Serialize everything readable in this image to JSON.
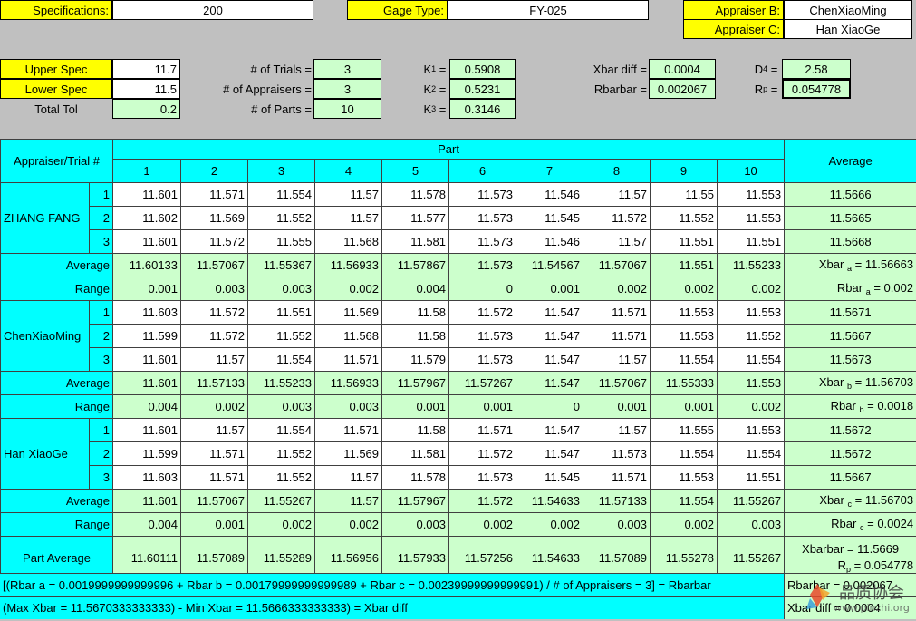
{
  "header": {
    "spec_label": "Specifications:",
    "spec_value": "200",
    "gage_type_label": "Gage Type:",
    "gage_type_value": "FY-025",
    "appraiser_b_label": "Appraiser B:",
    "appraiser_b_value": "ChenXiaoMing",
    "appraiser_c_label": "Appraiser C:",
    "appraiser_c_value": "Han XiaoGe"
  },
  "params": {
    "upper_spec_label": "Upper Spec",
    "upper_spec_value": "11.7",
    "lower_spec_label": "Lower Spec",
    "lower_spec_value": "11.5",
    "total_tol_label": "Total Tol",
    "total_tol_value": "0.2",
    "trials_label": "# of Trials =",
    "trials_value": "3",
    "appraisers_label": "# of Appraisers =",
    "appraisers_value": "3",
    "parts_label": "# of Parts =",
    "parts_value": "10",
    "k1_label": "K",
    "k1_sub": "1",
    "k1_value": "0.5908",
    "k2_label": "K",
    "k2_sub": "2",
    "k2_value": "0.5231",
    "k3_label": "K",
    "k3_sub": "3",
    "k3_value": "0.3146",
    "xbar_diff_label": "Xbar diff =",
    "xbar_diff_value": "0.0004",
    "rbarbar_label": "Rbarbar =",
    "rbarbar_value": "0.002067",
    "d4_label": "D",
    "d4_sub": "4",
    "d4_value": "2.58",
    "rp_label": "R",
    "rp_sub": "p",
    "rp_value": "0.054778"
  },
  "table": {
    "corner_label": "Appraiser/Trial #",
    "part_label": "Part",
    "average_header": "Average",
    "part_numbers": [
      "1",
      "2",
      "3",
      "4",
      "5",
      "6",
      "7",
      "8",
      "9",
      "10"
    ],
    "average_label": "Average",
    "range_label": "Range",
    "appraisers": [
      {
        "name": "ZHANG FANG",
        "trials": [
          {
            "no": "1",
            "values": [
              "11.601",
              "11.571",
              "11.554",
              "11.57",
              "11.578",
              "11.573",
              "11.546",
              "11.57",
              "11.55",
              "11.553"
            ],
            "avg": "11.5666"
          },
          {
            "no": "2",
            "values": [
              "11.602",
              "11.569",
              "11.552",
              "11.57",
              "11.577",
              "11.573",
              "11.545",
              "11.572",
              "11.552",
              "11.553"
            ],
            "avg": "11.5665"
          },
          {
            "no": "3",
            "values": [
              "11.601",
              "11.572",
              "11.555",
              "11.568",
              "11.581",
              "11.573",
              "11.546",
              "11.57",
              "11.551",
              "11.551"
            ],
            "avg": "11.5668"
          }
        ],
        "averages": [
          "11.60133",
          "11.57067",
          "11.55367",
          "11.56933",
          "11.57867",
          "11.573",
          "11.54567",
          "11.57067",
          "11.551",
          "11.55233"
        ],
        "xbar_text": "Xbar",
        "xbar_sub": "a",
        "xbar_value": "= 11.56663",
        "ranges": [
          "0.001",
          "0.003",
          "0.003",
          "0.002",
          "0.004",
          "0",
          "0.001",
          "0.002",
          "0.002",
          "0.002"
        ],
        "rbar_text": "Rbar",
        "rbar_sub": "a",
        "rbar_value": "= 0.002"
      },
      {
        "name": "ChenXiaoMing",
        "trials": [
          {
            "no": "1",
            "values": [
              "11.603",
              "11.572",
              "11.551",
              "11.569",
              "11.58",
              "11.572",
              "11.547",
              "11.571",
              "11.553",
              "11.553"
            ],
            "avg": "11.5671"
          },
          {
            "no": "2",
            "values": [
              "11.599",
              "11.572",
              "11.552",
              "11.568",
              "11.58",
              "11.573",
              "11.547",
              "11.571",
              "11.553",
              "11.552"
            ],
            "avg": "11.5667"
          },
          {
            "no": "3",
            "values": [
              "11.601",
              "11.57",
              "11.554",
              "11.571",
              "11.579",
              "11.573",
              "11.547",
              "11.57",
              "11.554",
              "11.554"
            ],
            "avg": "11.5673"
          }
        ],
        "averages": [
          "11.601",
          "11.57133",
          "11.55233",
          "11.56933",
          "11.57967",
          "11.57267",
          "11.547",
          "11.57067",
          "11.55333",
          "11.553"
        ],
        "xbar_text": "Xbar",
        "xbar_sub": "b",
        "xbar_value": "= 11.56703",
        "ranges": [
          "0.004",
          "0.002",
          "0.003",
          "0.003",
          "0.001",
          "0.001",
          "0",
          "0.001",
          "0.001",
          "0.002"
        ],
        "rbar_text": "Rbar",
        "rbar_sub": "b",
        "rbar_value": "= 0.0018"
      },
      {
        "name": "Han XiaoGe",
        "trials": [
          {
            "no": "1",
            "values": [
              "11.601",
              "11.57",
              "11.554",
              "11.571",
              "11.58",
              "11.571",
              "11.547",
              "11.57",
              "11.555",
              "11.553"
            ],
            "avg": "11.5672"
          },
          {
            "no": "2",
            "values": [
              "11.599",
              "11.571",
              "11.552",
              "11.569",
              "11.581",
              "11.572",
              "11.547",
              "11.573",
              "11.554",
              "11.554"
            ],
            "avg": "11.5672"
          },
          {
            "no": "3",
            "values": [
              "11.603",
              "11.571",
              "11.552",
              "11.57",
              "11.578",
              "11.573",
              "11.545",
              "11.571",
              "11.553",
              "11.551"
            ],
            "avg": "11.5667"
          }
        ],
        "averages": [
          "11.601",
          "11.57067",
          "11.55267",
          "11.57",
          "11.57967",
          "11.572",
          "11.54633",
          "11.57133",
          "11.554",
          "11.55267"
        ],
        "xbar_text": "Xbar",
        "xbar_sub": "c",
        "xbar_value": "= 11.56703",
        "ranges": [
          "0.004",
          "0.001",
          "0.002",
          "0.002",
          "0.003",
          "0.002",
          "0.002",
          "0.003",
          "0.002",
          "0.003"
        ],
        "rbar_text": "Rbar",
        "rbar_sub": "c",
        "rbar_value": "= 0.0024"
      }
    ],
    "part_average_label": "Part Average",
    "part_averages": [
      "11.60111",
      "11.57089",
      "11.55289",
      "11.56956",
      "11.57933",
      "11.57256",
      "11.54633",
      "11.57089",
      "11.55278",
      "11.55267"
    ],
    "xbarbar_text": "Xbarbar = 11.5669",
    "rp_text": "R",
    "rp_sub": "p",
    "rp_value": "= 0.054778"
  },
  "footer": {
    "formula1": "[(Rbar a = 0.0019999999999996 + Rbar b = 0.00179999999999989 + Rbar c = 0.00239999999999991) / # of Appraisers = 3] = Rbarbar",
    "formula1_tail": "Rbarbar = 0.002067",
    "formula2": "(Max Xbar = 11.5670333333333) - Min Xbar = 11.5666333333333) = Xbar diff",
    "formula2_tail": "Xbar diff = 0.0004"
  },
  "watermark": {
    "text": "品质协会",
    "url": "www.pinzhi.org"
  }
}
